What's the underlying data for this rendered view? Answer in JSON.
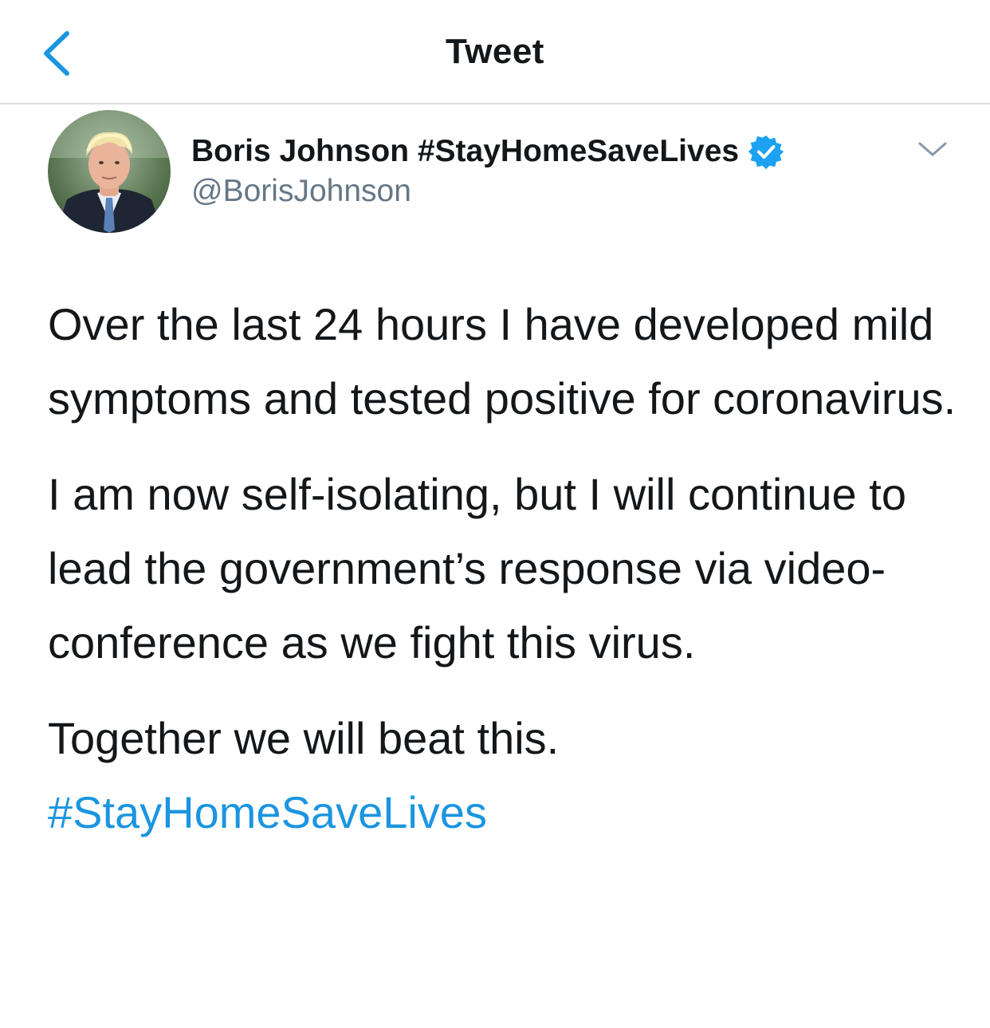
{
  "header": {
    "title": "Tweet",
    "back_icon": "chevron-left-icon"
  },
  "author": {
    "display_name": "Boris Johnson #StayHomeSaveLives",
    "handle": "@BorisJohnson",
    "verified": true,
    "verified_icon": "verified-badge-icon",
    "more_icon": "chevron-down-icon"
  },
  "tweet": {
    "paragraphs": [
      "Over the last 24 hours I have developed mild symptoms and tested positive for coronavirus.",
      "I am now self-isolating, but I will continue to lead the government’s response via video-conference as we fight this virus.",
      "Together we will beat this."
    ],
    "hashtag": "#StayHomeSaveLives"
  },
  "colors": {
    "accent": "#1b95e0",
    "text": "#14171a",
    "secondary_text": "#657786",
    "divider": "#d9dde1",
    "verified": "#1da1f2"
  }
}
